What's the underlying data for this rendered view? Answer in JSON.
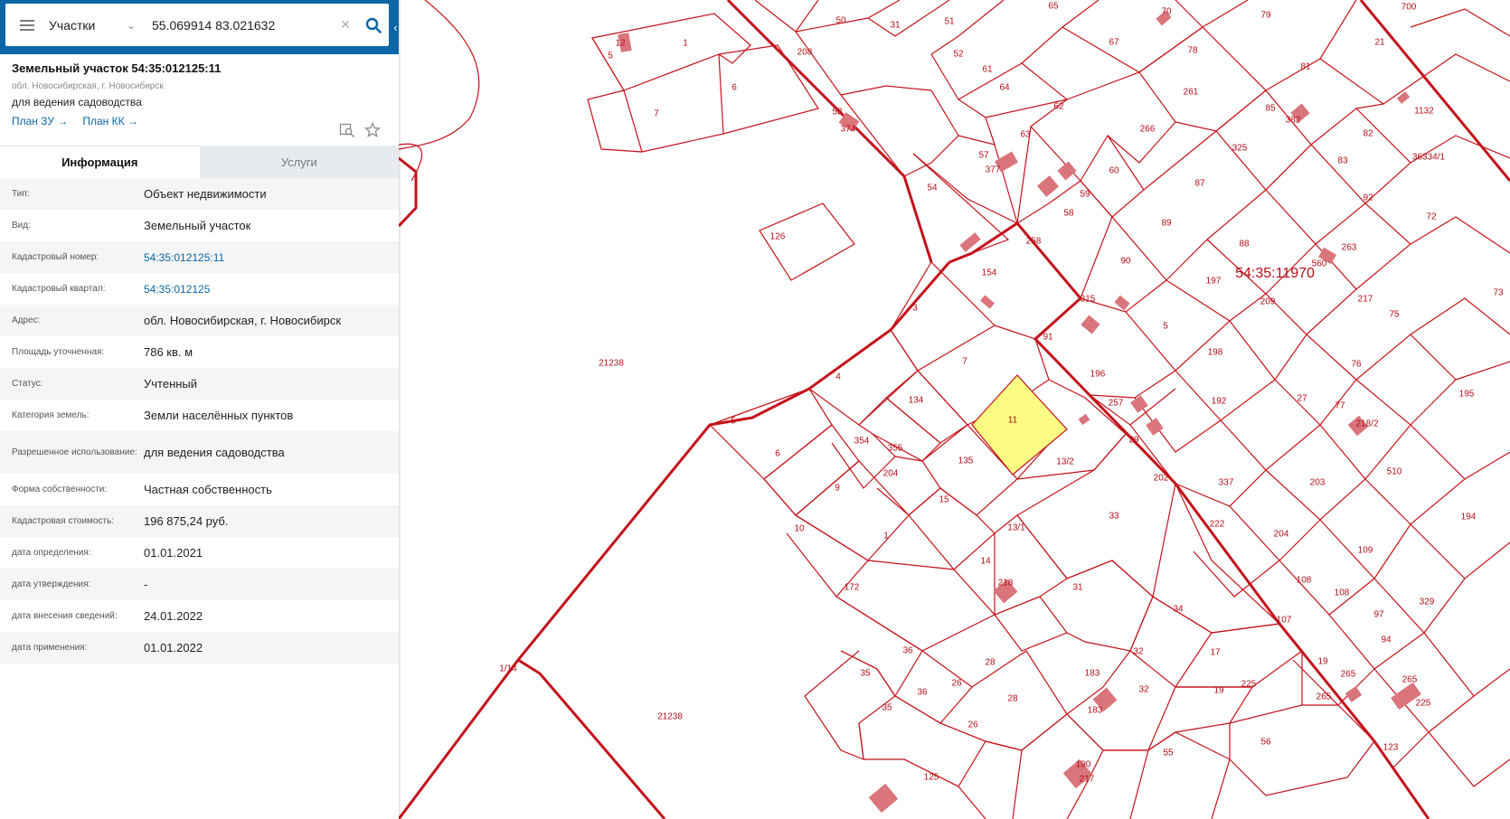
{
  "search": {
    "type_label": "Участки",
    "query": "55.069914 83.021632"
  },
  "object": {
    "title": "Земельный участок 54:35:012125:11",
    "address_short": "обл. Новосибирская, г. Новосибирск",
    "usage_short": "для ведения садоводства",
    "plan_zu": "План ЗУ →",
    "plan_kk": "План КК →"
  },
  "tabs": [
    {
      "label": "Информация",
      "active": true
    },
    {
      "label": "Услуги",
      "active": false
    }
  ],
  "info": [
    {
      "key": "Тип:",
      "value": "Объект недвижимости"
    },
    {
      "key": "Вид:",
      "value": "Земельный участок"
    },
    {
      "key": "Кадастровый номер:",
      "value": "54:35:012125:11"
    },
    {
      "key": "Кадастровый квартал:",
      "value": "54:35:012125"
    },
    {
      "key": "Адрес:",
      "value": "обл. Новосибирская, г. Новосибирск"
    },
    {
      "key": "Площадь уточненная:",
      "value": "786 кв. м"
    },
    {
      "key": "Статус:",
      "value": "Учтенный"
    },
    {
      "key": "Категория земель:",
      "value": "Земли населённых пунктов"
    },
    {
      "key": "Разрешенное использование:",
      "value": "для ведения садоводства"
    },
    {
      "key": "Форма собственности:",
      "value": "Частная собственность"
    },
    {
      "key": "Кадастровая стоимость:",
      "value": "196 875,24 руб."
    },
    {
      "key": "дата определения:",
      "value": "01.01.2021"
    },
    {
      "key": "дата утверждения:",
      "value": "-"
    },
    {
      "key": "дата внесения сведений:",
      "value": "24.01.2022"
    },
    {
      "key": "дата применения:",
      "value": "01.01.2022"
    }
  ],
  "map": {
    "quarter_label": "54:35:11970",
    "line_color": "#c4121b",
    "selected_fill": "#fdfd84",
    "building_fill": "#d9757b",
    "parcel_labels": [
      "50",
      "31",
      "51",
      "65",
      "70",
      "79",
      "700",
      "208",
      "1",
      "5",
      "12",
      "6",
      "7",
      "52",
      "61",
      "64",
      "67",
      "78",
      "81",
      "21",
      "53",
      "374",
      "63",
      "62",
      "261",
      "85",
      "382",
      "1132",
      "57",
      "377",
      "266",
      "325",
      "82",
      "54",
      "59",
      "60",
      "87",
      "83",
      "36334/1",
      "126",
      "58",
      "258",
      "89",
      "92",
      "72",
      "154",
      "88",
      "263",
      "560",
      "90",
      "315",
      "197",
      "209",
      "217",
      "73",
      "3",
      "91",
      "5",
      "198",
      "75",
      "21238",
      "7",
      "196",
      "257",
      "192",
      "27",
      "76",
      "4",
      "134",
      "11",
      "29",
      "77",
      "195",
      "5",
      "6",
      "354",
      "355",
      "135",
      "13/2",
      "202",
      "337",
      "510",
      "203",
      "218/2",
      "9",
      "204",
      "15",
      "33",
      "222",
      "204",
      "194",
      "10",
      "1",
      "13/1",
      "14",
      "218",
      "31",
      "109",
      "172",
      "34",
      "108",
      "108",
      "97",
      "329",
      "107",
      "94",
      "36",
      "28",
      "32",
      "17",
      "19",
      "265",
      "265",
      "225",
      "35",
      "36",
      "26",
      "183",
      "32",
      "265",
      "225",
      "35",
      "28",
      "183",
      "19",
      "56",
      "1/14",
      "21238",
      "26",
      "55",
      "123",
      "190",
      "217",
      "125"
    ]
  }
}
